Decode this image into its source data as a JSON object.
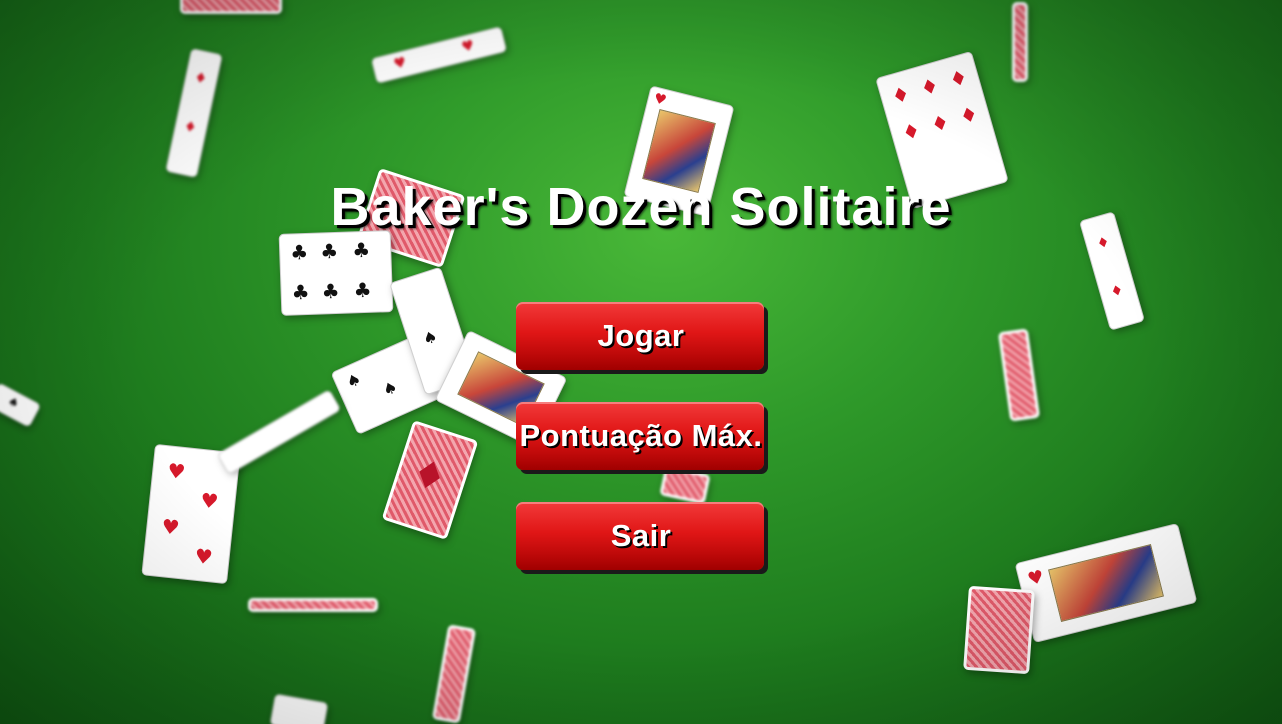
{
  "game": {
    "title": "Baker's Dozen Solitaire"
  },
  "menu": {
    "play_label": "Jogar",
    "highscore_label": "Pontuação Máx.",
    "exit_label": "Sair"
  },
  "colors": {
    "felt": "#2f9a2a",
    "button": "#e01616",
    "title_text": "#ffffff"
  },
  "background_cards": {
    "card_back_icon": "card-back",
    "suits": [
      "club-icon",
      "diamond-icon",
      "heart-icon",
      "spade-icon"
    ]
  }
}
